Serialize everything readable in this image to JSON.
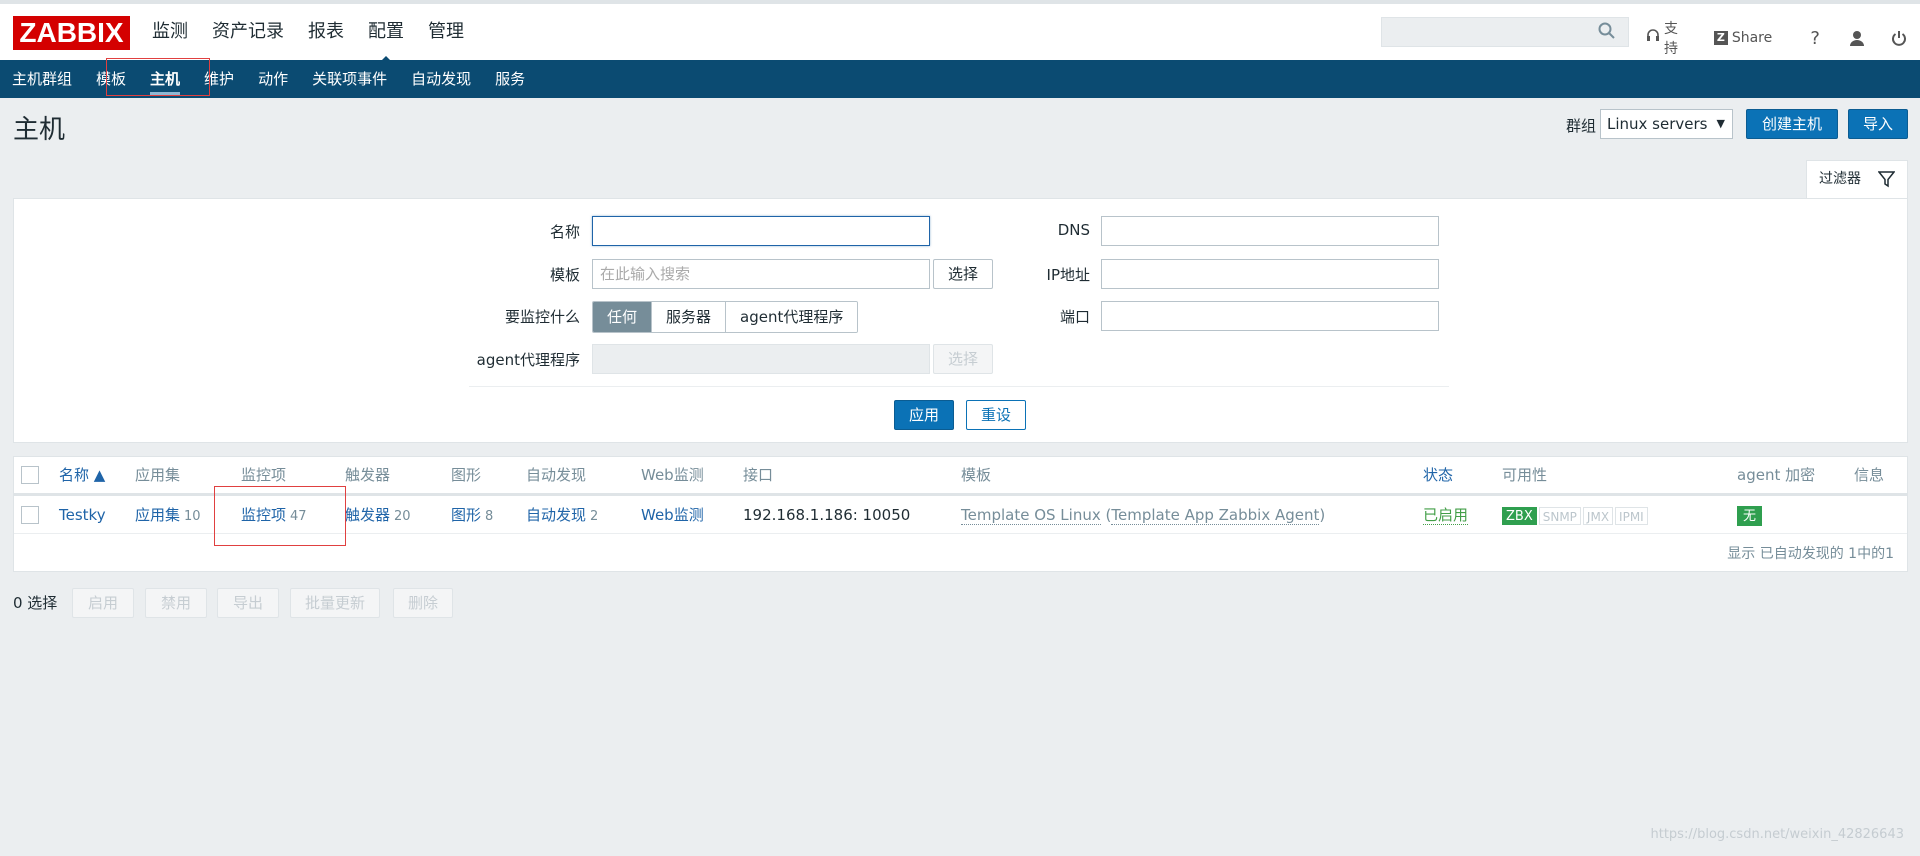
{
  "brand": {
    "logo": "ZABBIX"
  },
  "main_menu": [
    "监测",
    "资产记录",
    "报表",
    "配置",
    "管理"
  ],
  "top_links": {
    "support": "支持",
    "share": "Share",
    "help": "?"
  },
  "sub_menu": [
    "主机群组",
    "模板",
    "主机",
    "维护",
    "动作",
    "关联项事件",
    "自动发现",
    "服务"
  ],
  "header": {
    "title": "主机",
    "group_label": "群组",
    "group_value": "Linux servers",
    "create_button": "创建主机",
    "import_button": "导入"
  },
  "filter": {
    "tab_label": "过滤器",
    "name_label": "名称",
    "name_value": "",
    "template_label": "模板",
    "template_placeholder": "在此输入搜索",
    "select_button": "选择",
    "monitored_by_label": "要监控什么",
    "monitored_by_options": [
      "任何",
      "服务器",
      "agent代理程序"
    ],
    "monitored_by_selected": "任何",
    "proxy_label": "agent代理程序",
    "proxy_select_button": "选择",
    "dns_label": "DNS",
    "ip_label": "IP地址",
    "port_label": "端口",
    "apply_button": "应用",
    "reset_button": "重设"
  },
  "table": {
    "headers": {
      "name": "名称 ▲",
      "applications": "应用集",
      "items": "监控项",
      "triggers": "触发器",
      "graphs": "图形",
      "discovery": "自动发现",
      "web": "Web监测",
      "interface": "接口",
      "templates": "模板",
      "status": "状态",
      "availability": "可用性",
      "encryption": "agent 加密",
      "info": "信息"
    },
    "rows": [
      {
        "name": "Testky",
        "applications": "应用集",
        "applications_count": "10",
        "items": "监控项",
        "items_count": "47",
        "triggers": "触发器",
        "triggers_count": "20",
        "graphs": "图形",
        "graphs_count": "8",
        "discovery": "自动发现",
        "discovery_count": "2",
        "web": "Web监测",
        "interface": "192.168.1.186: 10050",
        "template_main": "Template OS Linux",
        "template_paren_open": " (",
        "template_sub": "Template App Zabbix Agent",
        "template_paren_close": ")",
        "status": "已启用",
        "availability": [
          "ZBX",
          "SNMP",
          "JMX",
          "IPMI"
        ],
        "encryption": "无"
      }
    ],
    "footer": "显示 已自动发现的 1中的1"
  },
  "bulk": {
    "selected": "0 选择",
    "buttons": [
      "启用",
      "禁用",
      "导出",
      "批量更新",
      "删除"
    ]
  },
  "watermark": "https://blog.csdn.net/weixin_42826643",
  "colors": {
    "brand_red": "#d40000",
    "nav_blue": "#0b4b72",
    "primary_button": "#0b72b6",
    "link": "#1f64a8",
    "enabled_green": "#429e47"
  }
}
